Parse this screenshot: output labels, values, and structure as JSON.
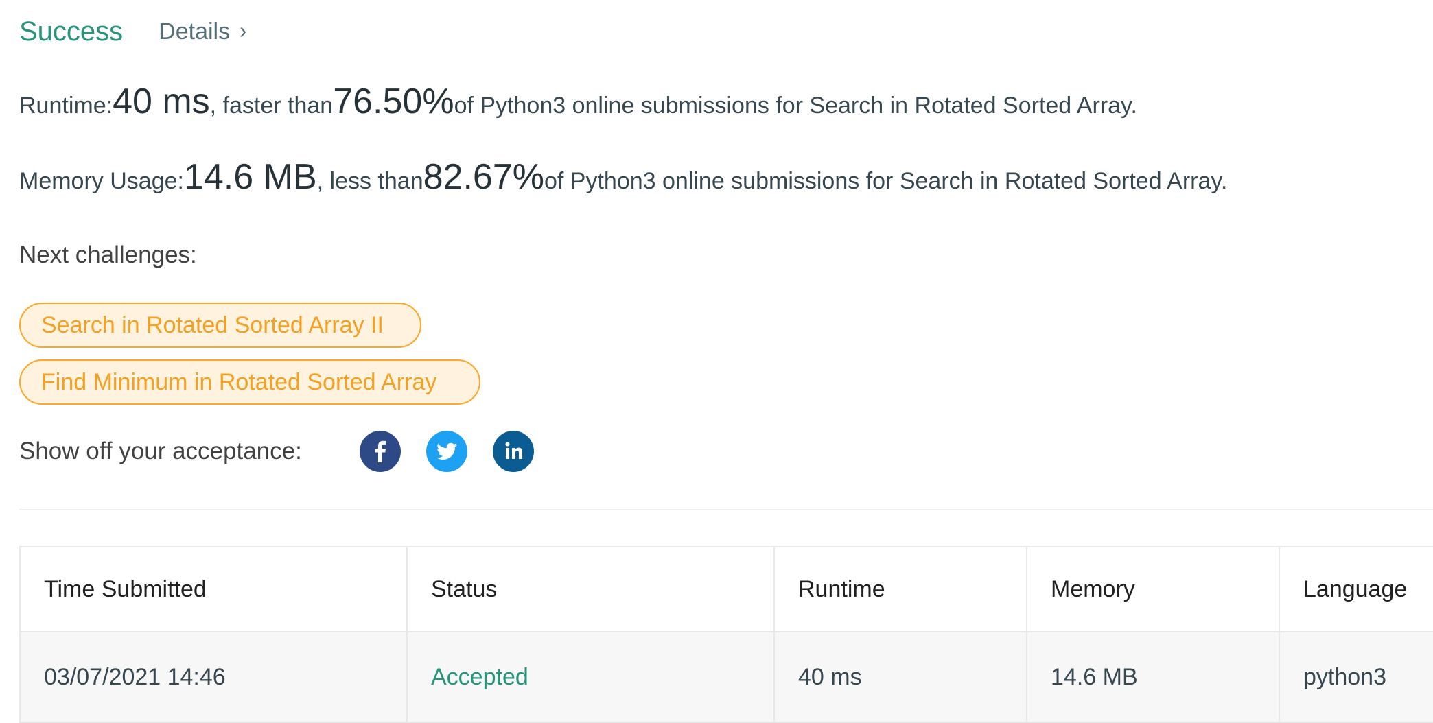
{
  "header": {
    "status": "Success",
    "details_label": "Details",
    "details_chevron": "›"
  },
  "runtime_stat": {
    "label": "Runtime: ",
    "value": "40 ms",
    "comparison": ", faster than ",
    "percent": "76.50%",
    "suffix": " of Python3 online submissions for Search in Rotated Sorted Array."
  },
  "memory_stat": {
    "label": "Memory Usage: ",
    "value": "14.6 MB",
    "comparison": ", less than ",
    "percent": "82.67%",
    "suffix": " of Python3 online submissions for Search in Rotated Sorted Array."
  },
  "next_challenges": {
    "label": "Next challenges:",
    "items": [
      {
        "label": "Search in Rotated Sorted Array II"
      },
      {
        "label": "Find Minimum in Rotated Sorted Array"
      }
    ]
  },
  "share": {
    "label": "Show off your acceptance:",
    "icons": [
      "facebook-icon",
      "twitter-icon",
      "linkedin-icon"
    ]
  },
  "table": {
    "columns": [
      "Time Submitted",
      "Status",
      "Runtime",
      "Memory",
      "Language"
    ],
    "rows": [
      {
        "time": "03/07/2021 14:46",
        "status": "Accepted",
        "runtime": "40 ms",
        "memory": "14.6 MB",
        "language": "python3"
      }
    ]
  },
  "colors": {
    "success": "#26957b",
    "chip_text": "#f5a020",
    "chip_border": "#ffa726",
    "chip_bg": "#fff3e0",
    "facebook": "#2d4a86",
    "twitter": "#1da1f2",
    "linkedin": "#0c5c94"
  }
}
